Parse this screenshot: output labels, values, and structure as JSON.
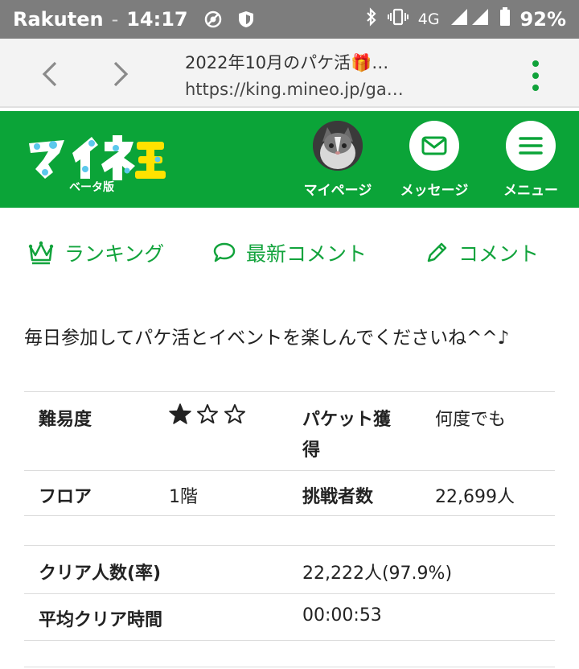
{
  "status_bar": {
    "carrier": "Rakuten",
    "separator": "-",
    "time": "14:17",
    "network": "4G",
    "battery": "92%"
  },
  "browser": {
    "page_title": "2022年10月のパケ活🎁…",
    "url": "https://king.mineo.jp/ga…"
  },
  "site_header": {
    "logo_subtitle": "ベータ版",
    "mypage_label": "マイページ",
    "message_label": "メッセージ",
    "menu_label": "メニュー"
  },
  "sub_nav": {
    "ranking": "ランキング",
    "latest_comments": "最新コメント",
    "comment": "コメント"
  },
  "intro_text": "毎日参加してパケ活とイベントを楽しんでくださいね^^♪",
  "info_table": {
    "difficulty_label": "難易度",
    "difficulty_rating": 1,
    "difficulty_max": 5,
    "packet_label_line1": "パケット獲",
    "packet_label_line2": "得",
    "packet_value": "何度でも",
    "floor_label": "フロア",
    "floor_value": "1階",
    "challengers_label": "挑戦者数",
    "challengers_value": "22,699人",
    "clear_count_label": "クリア人数(率)",
    "clear_count_value": "22,222人(97.9%)",
    "avg_time_label": "平均クリア時間",
    "avg_time_value": "00:00:53"
  },
  "colors": {
    "brand_green": "#0ba438",
    "status_bar": "#7d7d7d",
    "browser_bar": "#f3f3f3"
  },
  "icons": [
    "no-sim-icon",
    "shield-icon",
    "bluetooth-icon",
    "vibrate-icon",
    "signal-icon",
    "battery-icon",
    "back-arrow-icon",
    "forward-arrow-icon",
    "kebab-menu-icon",
    "mail-icon",
    "hamburger-icon",
    "crown-icon",
    "speech-bubble-icon",
    "pencil-icon",
    "star-icon"
  ]
}
